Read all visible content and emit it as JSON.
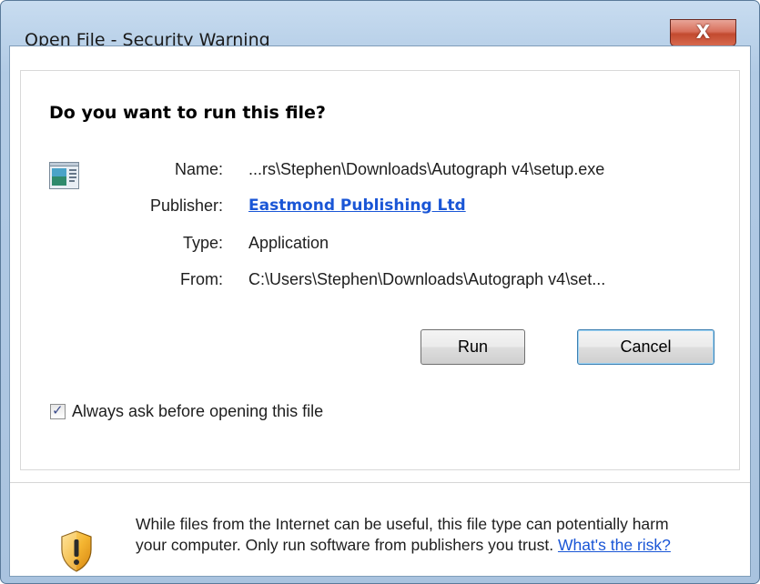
{
  "window": {
    "title": "Open File - Security Warning",
    "close_glyph": "X"
  },
  "dialog": {
    "heading": "Do you want to run this file?",
    "file_icon": "application-window-icon",
    "fields": {
      "name_label": "Name:",
      "name_value": "...rs\\Stephen\\Downloads\\Autograph v4\\setup.exe",
      "publisher_label": "Publisher:",
      "publisher_value": "Eastmond Publishing Ltd",
      "type_label": "Type:",
      "type_value": "Application",
      "from_label": "From:",
      "from_value": "C:\\Users\\Stephen\\Downloads\\Autograph v4\\set..."
    },
    "buttons": {
      "run_label": "Run",
      "cancel_label": "Cancel"
    },
    "checkbox": {
      "label": "Always ask before opening this file",
      "checked": true
    }
  },
  "warning": {
    "icon": "shield-warning-icon",
    "text": "While files from the Internet can be useful, this file type can potentially harm your computer. Only run software from publishers you trust.",
    "link_text": "What's the risk?"
  },
  "colors": {
    "link": "#1a56d6",
    "close_button": "#c24a2f",
    "title_bar": "#b2cbe5",
    "shield": "#f0a820"
  }
}
